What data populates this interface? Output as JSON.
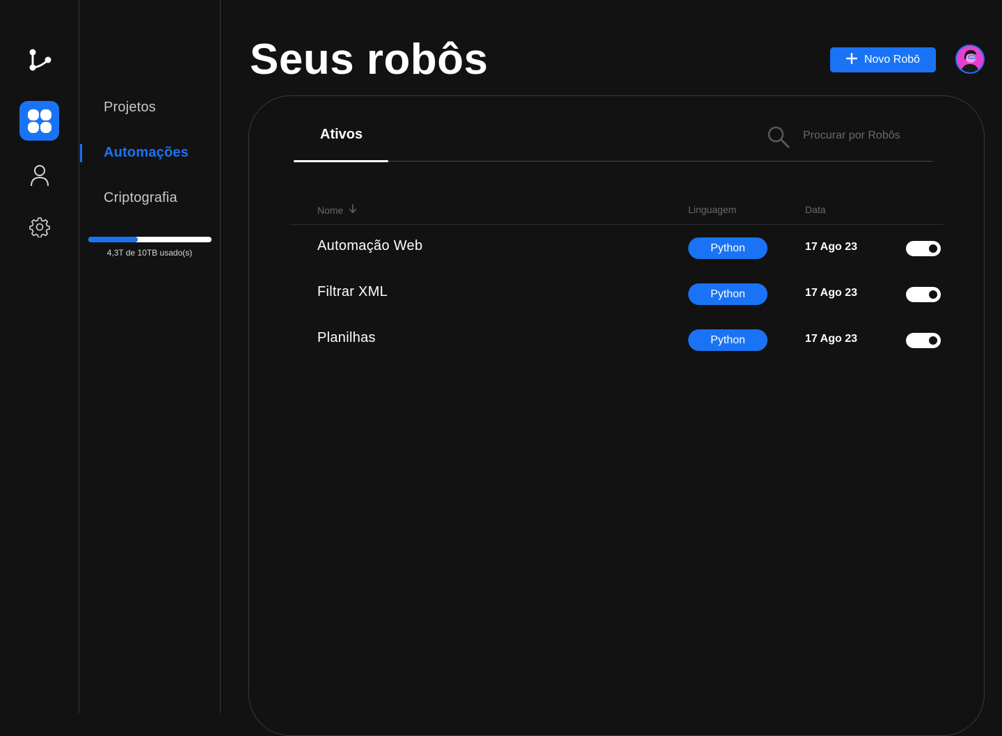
{
  "rail": {
    "icons": [
      "branch-logo-icon",
      "apps-grid-icon",
      "user-icon",
      "settings-gear-icon"
    ]
  },
  "sidebar": {
    "items": [
      {
        "label": "Projetos",
        "active": false
      },
      {
        "label": "Automações",
        "active": true
      },
      {
        "label": "Criptografia",
        "active": false
      }
    ],
    "storage": {
      "used_fraction": 0.4,
      "label": "4,3T de 10TB usado(s)"
    }
  },
  "header": {
    "title": "Seus robôs",
    "new_button_label": "Novo Robô"
  },
  "panel": {
    "tab_active": "Ativos",
    "search_placeholder": "Procurar por Robôs",
    "columns": {
      "name": "Nome",
      "language": "Linguagem",
      "date": "Data"
    },
    "rows": [
      {
        "name": "Automação Web",
        "language": "Python",
        "date": "17 Ago 23",
        "enabled": true
      },
      {
        "name": "Filtrar XML",
        "language": "Python",
        "date": "17 Ago 23",
        "enabled": true
      },
      {
        "name": "Planilhas",
        "language": "Python",
        "date": "17 Ago 23",
        "enabled": true
      }
    ]
  },
  "colors": {
    "accent": "#1a73f4",
    "background": "#121212",
    "avatar_bg": "#e83fd0"
  }
}
